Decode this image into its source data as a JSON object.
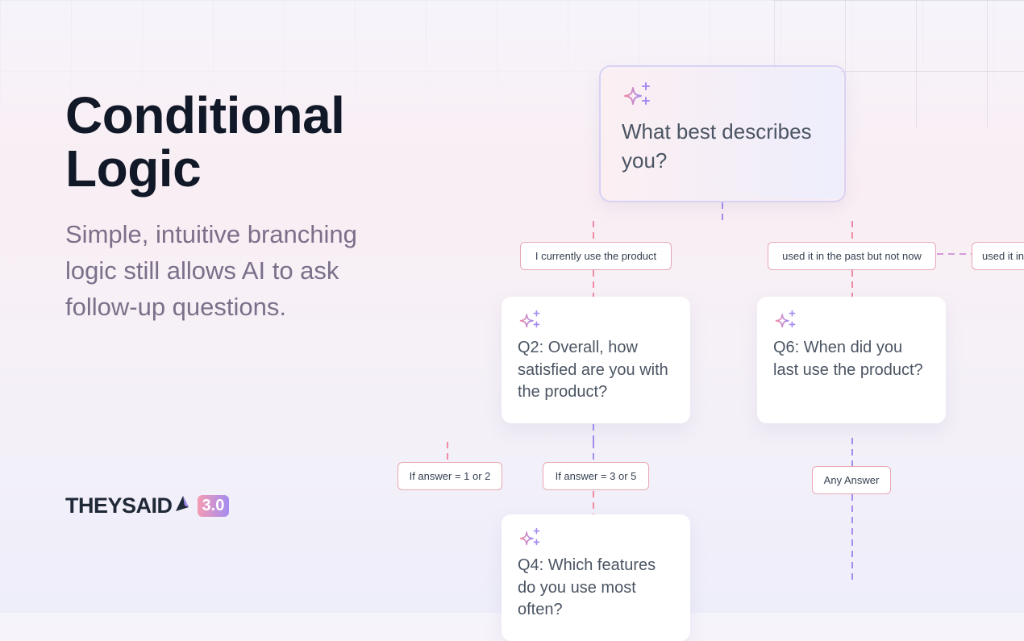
{
  "hero": {
    "title_line1": "Conditional",
    "title_line2": "Logic",
    "subtitle": "Simple, intuitive branching logic still allows AI to ask follow-up questions."
  },
  "brand": {
    "name": "THEYSAID",
    "version": "3.0",
    "accent_pink": "#f59ab3",
    "accent_purple": "#a48cf0"
  },
  "flow": {
    "root_question": "What best describes you?",
    "branches": [
      "I currently use the product",
      "used it in the past but not now",
      "used it in"
    ],
    "cards": [
      {
        "id": "q2",
        "text": "Q2: Overall, how satisfied are you with the product?"
      },
      {
        "id": "q6",
        "text": "Q6: When did you last use the product?"
      },
      {
        "id": "q4",
        "text": "Q4: Which features do you use most often?"
      }
    ],
    "conditions": [
      "If answer = 1 or 2",
      "If answer = 3 or 5",
      "Any Answer"
    ]
  }
}
